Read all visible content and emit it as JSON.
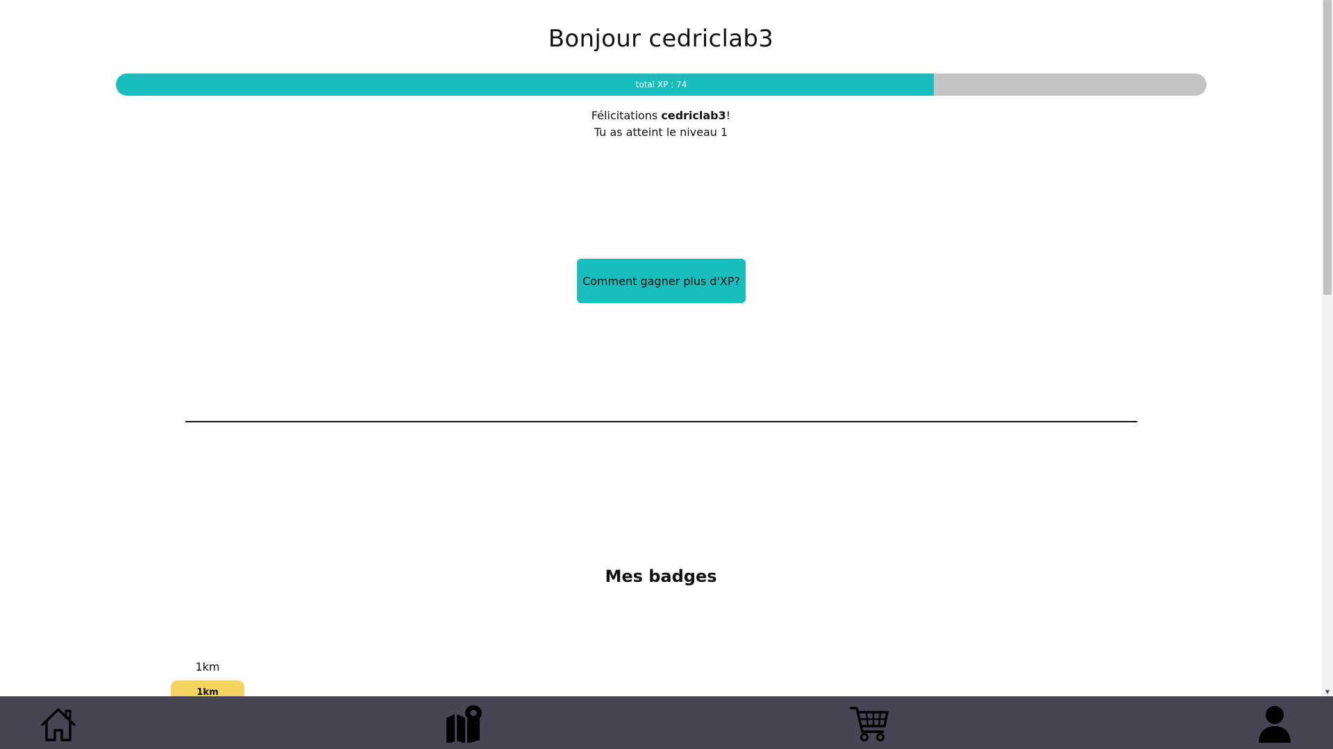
{
  "header": {
    "greeting": "Bonjour cedriclab3"
  },
  "xp": {
    "label": "total XP : 74",
    "progress_fraction": 0.75,
    "fill_color": "#17bebb",
    "track_color": "#c4c4c4"
  },
  "congrats": {
    "prefix": "Félicitations ",
    "username": "cedriclab3",
    "suffix": "!",
    "level_line": "Tu as atteint le niveau 1"
  },
  "cta": {
    "label": "Comment gagner plus d'XP?"
  },
  "badges": {
    "title": "Mes badges",
    "items": [
      {
        "name": "1km",
        "ribbon": "1km",
        "color": "#f4d35e"
      }
    ]
  },
  "nav": {
    "items": [
      {
        "icon": "home-icon"
      },
      {
        "icon": "map-pin-icon"
      },
      {
        "icon": "shopping-cart-icon"
      },
      {
        "icon": "user-icon"
      }
    ],
    "background": "#474554"
  }
}
